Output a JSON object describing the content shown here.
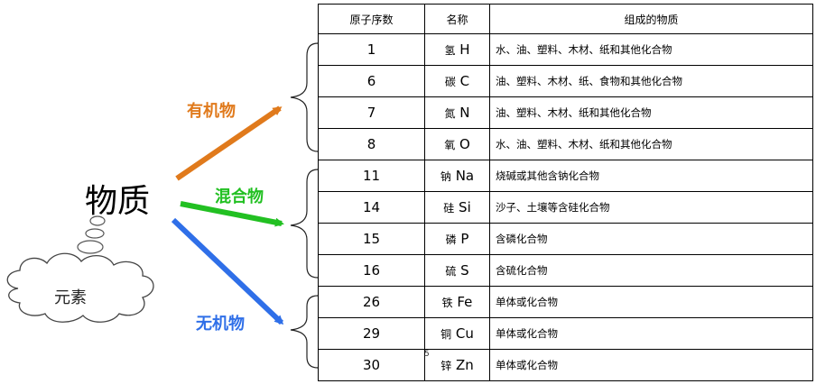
{
  "diagram": {
    "title": "物质",
    "cloud_label": "元素",
    "branches": [
      {
        "label": "有机物",
        "color": "#e07a1c"
      },
      {
        "label": "混合物",
        "color": "#22c022"
      },
      {
        "label": "无机物",
        "color": "#2f6fe8"
      }
    ]
  },
  "table": {
    "headers": [
      "原子序数",
      "名称",
      "组成的物质"
    ],
    "rows": [
      {
        "number": "1",
        "name_zh": "氢",
        "symbol": "H",
        "composition": "水、油、塑料、木材、纸和其他化合物"
      },
      {
        "number": "6",
        "name_zh": "碳",
        "symbol": "C",
        "composition": "油、塑料、木材、纸、食物和其他化合物"
      },
      {
        "number": "7",
        "name_zh": "氮",
        "symbol": "N",
        "composition": "油、塑料、木材、纸和其他化合物"
      },
      {
        "number": "8",
        "name_zh": "氧",
        "symbol": "O",
        "composition": "水、油、塑料、木材、纸和其他化合物"
      },
      {
        "number": "11",
        "name_zh": "钠",
        "symbol": "Na",
        "composition": "烧碱或其他含钠化合物"
      },
      {
        "number": "14",
        "name_zh": "硅",
        "symbol": "Si",
        "composition": "沙子、土壤等含硅化合物"
      },
      {
        "number": "15",
        "name_zh": "磷",
        "symbol": "P",
        "composition": "含磷化合物"
      },
      {
        "number": "16",
        "name_zh": "硫",
        "symbol": "S",
        "composition": "含硫化合物"
      },
      {
        "number": "26",
        "name_zh": "铁",
        "symbol": "Fe",
        "composition": "单体或化合物"
      },
      {
        "number": "29",
        "name_zh": "铜",
        "symbol": "Cu",
        "composition": "单体或化合物"
      },
      {
        "number": "30",
        "name_zh": "锌",
        "symbol": "Zn",
        "composition": "单体或化合物"
      }
    ]
  },
  "stray_mark": "5"
}
